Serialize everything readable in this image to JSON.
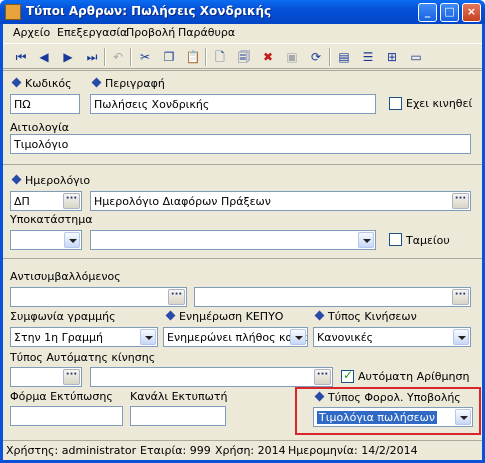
{
  "window": {
    "title": "Τύποι Αρθρων: Πωλήσεις Χονδρικής",
    "buttons": {
      "minimize": "_",
      "maximize": "□",
      "close": "×"
    }
  },
  "menu": [
    "Αρχείο",
    "Επεξεργασία",
    "Προβολή",
    "Παράθυρα"
  ],
  "toolbar": {
    "icons": [
      "first-icon",
      "prev-icon",
      "next-icon",
      "last-icon",
      "undo-icon",
      "cut-icon",
      "copy-icon",
      "paste-icon",
      "new-icon",
      "copy-record-icon",
      "delete-icon",
      "save-icon",
      "refresh-icon",
      "form-icon",
      "list-icon",
      "tree-icon",
      "window-icon"
    ]
  },
  "section1": {
    "code_label": "Κωδικός",
    "code_value": "ΠΩ",
    "desc_label": "Περιγραφή",
    "desc_value": "Πωλήσεις Χονδρικής",
    "movements_label": "Εχει κινηθεί",
    "reason_label": "Αιτιολογία",
    "reason_value": "Τιμολόγιο"
  },
  "section2": {
    "journal_label": "Ημερολόγιο",
    "journal_code": "ΔΠ",
    "journal_desc": "Ημερολόγιο Διαφόρων Πράξεων",
    "branch_label": "Υποκατάστημα",
    "cash_label": "Ταμείου"
  },
  "section3": {
    "counterparty_label": "Αντισυμβαλλόμενος",
    "line_agreement_label": "Συμφωνία γραμμής",
    "line_agreement_value": "Στην 1η Γραμμή",
    "kepyo_label": "Ενημέρωση ΚΕΠΥΟ",
    "kepyo_value": "Ενημερώνει πλήθος και α",
    "movement_type_label": "Τύπος Κινήσεων",
    "movement_type_value": "Κανονικές",
    "auto_movement_label": "Τύπος Αυτόματης κίνησης",
    "auto_numbering_label": "Αυτόματη Αρίθμηση",
    "print_form_label": "Φόρμα Εκτύπωσης",
    "print_channel_label": "Κανάλι Εκτυπωτή",
    "tax_submission_label": "Τύπος Φορολ. Υποβολής",
    "tax_submission_value": "Τιμολόγια πωλήσεων"
  },
  "status": {
    "user": "Χρήστης: administrator",
    "company": "Εταιρία: 999",
    "year": "Χρήση: 2014",
    "date": "Ημερομηνία: 14/2/2014"
  },
  "colors": {
    "title_bar": "#0550d6",
    "highlight_border": "#d8262c",
    "selection": "#316ac5",
    "form_bg": "#ece9d8"
  }
}
